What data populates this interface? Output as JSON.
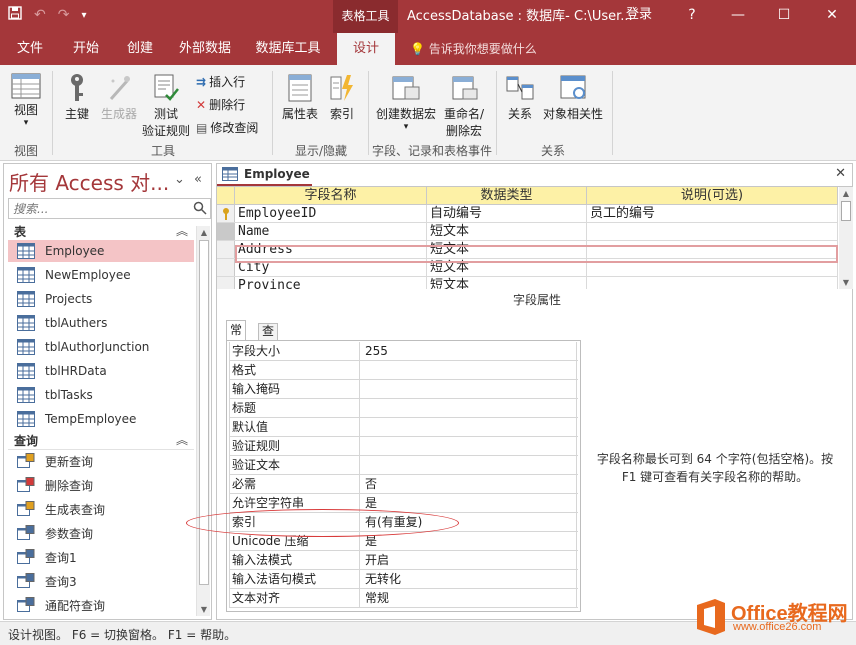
{
  "window": {
    "context_tab_title": "表格工具",
    "title": "AccessDatabase : 数据库- C:\\User...",
    "sign_in": "登录",
    "help": "?",
    "minimize": "—",
    "restore": "☐",
    "close": "✕"
  },
  "ribbon_tabs": [
    "文件",
    "开始",
    "创建",
    "外部数据",
    "数据库工具",
    "设计"
  ],
  "tell_me": "告诉我你想要做什么",
  "ribbon": {
    "view_label": "视图",
    "view_group": "视图",
    "primary_key_label": "主键",
    "builder_label": "生成器",
    "test_rules_label_1": "测试",
    "test_rules_label_2": "验证规则",
    "insert_rows_label": "插入行",
    "delete_rows_label": "删除行",
    "modify_lookups_label": "修改查阅",
    "tools_group": "工具",
    "property_sheet_label": "属性表",
    "indexes_label": "索引",
    "show_hide_group": "显示/隐藏",
    "create_macro_label": "创建数据宏",
    "rename_macro_label_1": "重命名/",
    "rename_macro_label_2": "删除宏",
    "events_group": "字段、记录和表格事件",
    "relationships_label": "关系",
    "dependencies_label": "对象相关性",
    "relationships_group": "关系"
  },
  "nav": {
    "title": "所有 Access 对...",
    "search_placeholder": "搜索...",
    "groups": [
      {
        "label": "表",
        "items": [
          "Employee",
          "NewEmployee",
          "Projects",
          "tblAuthers",
          "tblAuthorJunction",
          "tblHRData",
          "tblTasks",
          "TempEmployee"
        ]
      },
      {
        "label": "查询",
        "items": [
          "更新查询",
          "删除查询",
          "生成表查询",
          "参数查询",
          "查询1",
          "查询3",
          "通配符查询"
        ]
      }
    ]
  },
  "document": {
    "tab_label": "Employee",
    "close": "✕",
    "columns": [
      "字段名称",
      "数据类型",
      "说明(可选)"
    ],
    "rows": [
      {
        "name": "EmployeeID",
        "type": "自动编号",
        "desc": "员工的编号"
      },
      {
        "name": "Name",
        "type": "短文本",
        "desc": ""
      },
      {
        "name": "Address",
        "type": "短文本",
        "desc": ""
      },
      {
        "name": "City",
        "type": "短文本",
        "desc": ""
      },
      {
        "name": "Province",
        "type": "短文本",
        "desc": ""
      }
    ],
    "field_properties_title": "字段属性",
    "prop_tabs": [
      "常规",
      "查阅"
    ],
    "properties": [
      {
        "name": "字段大小",
        "value": "255"
      },
      {
        "name": "格式",
        "value": ""
      },
      {
        "name": "输入掩码",
        "value": ""
      },
      {
        "name": "标题",
        "value": ""
      },
      {
        "name": "默认值",
        "value": ""
      },
      {
        "name": "验证规则",
        "value": ""
      },
      {
        "name": "验证文本",
        "value": ""
      },
      {
        "name": "必需",
        "value": "否"
      },
      {
        "name": "允许空字符串",
        "value": "是"
      },
      {
        "name": "索引",
        "value": "有(有重复)"
      },
      {
        "name": "Unicode 压缩",
        "value": "是"
      },
      {
        "name": "输入法模式",
        "value": "开启"
      },
      {
        "name": "输入法语句模式",
        "value": "无转化"
      },
      {
        "name": "文本对齐",
        "value": "常规"
      }
    ],
    "help_text": "字段名称最长可到 64 个字符(包括空格)。按 F1 键可查看有关字段名称的帮助。"
  },
  "status": {
    "text": "设计视图。   F6 = 切换窗格。   F1 = 帮助。"
  },
  "watermark": {
    "brand": "Office教程网",
    "url": "www.office26.com"
  },
  "colors": {
    "accent": "#a4373a",
    "header_yellow": "#fdf1a6",
    "selected_item": "#f4c4c6",
    "annotation": "#d83b3b",
    "watermark": "#e8691e"
  }
}
